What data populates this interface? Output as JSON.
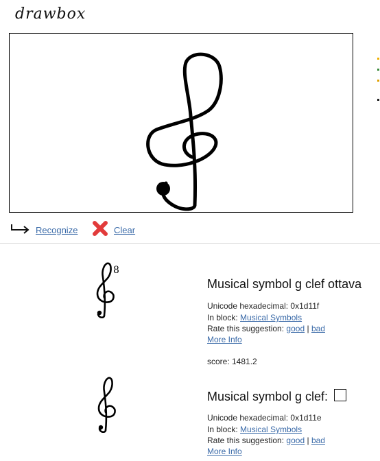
{
  "app": {
    "logo": "drawbox"
  },
  "toolbar": {
    "recognize_label": "Recognize",
    "clear_label": "Clear"
  },
  "colors": {
    "link": "#3a6aa8",
    "clear_icon": "#e23b3b",
    "divider": "#d6d6d6",
    "side_marks": [
      "#f0b000",
      "#3b8a3b",
      "#e0a000"
    ]
  },
  "results": [
    {
      "title": "Musical symbol g clef ottava",
      "unicode_label": "Unicode hexadecimal:",
      "unicode_value": "0x1d11f",
      "block_label": "In block:",
      "block_link": "Musical Symbols",
      "rate_label": "Rate this suggestion:",
      "good": "good",
      "separator": "|",
      "bad": "bad",
      "more_info": "More Info",
      "score": "score: 1481.2",
      "glyph_superscript": "8"
    },
    {
      "title": "Musical symbol g clef:",
      "unicode_label": "Unicode hexadecimal:",
      "unicode_value": "0x1d11e",
      "block_label": "In block:",
      "block_link": "Musical Symbols",
      "rate_label": "Rate this suggestion:",
      "good": "good",
      "separator": "|",
      "bad": "bad",
      "more_info": "More Info"
    }
  ]
}
